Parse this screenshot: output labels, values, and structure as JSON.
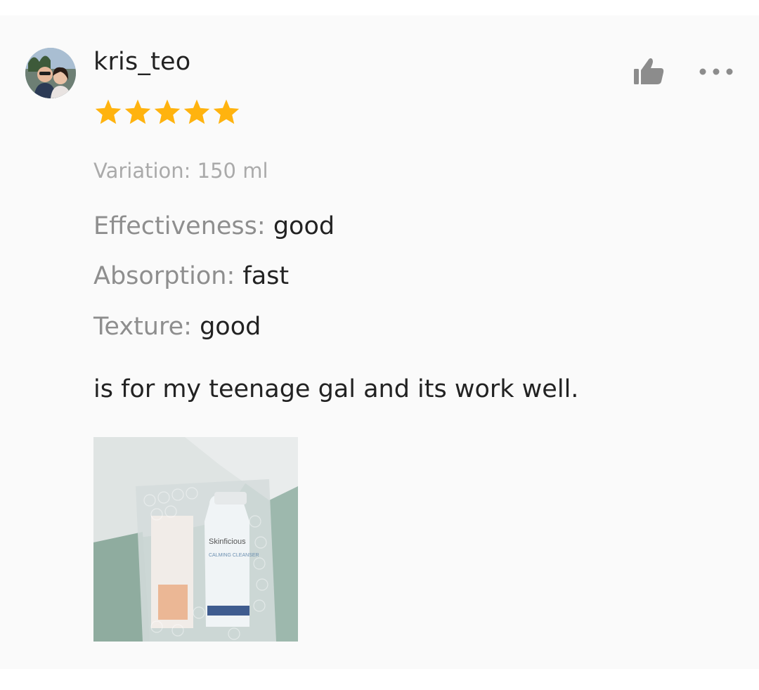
{
  "review": {
    "username": "kris_teo",
    "avatar": "avatar-photo",
    "rating": 5,
    "rating_max": 5,
    "star_color": "#ffb30f",
    "variation": "Variation: 150 ml",
    "attributes": [
      {
        "label": "Effectiveness:",
        "value": "good"
      },
      {
        "label": "Absorption:",
        "value": "fast"
      },
      {
        "label": "Texture:",
        "value": "good"
      }
    ],
    "comment": "is for my teenage gal and its work well.",
    "photo": {
      "icon": "product-photo",
      "bottle_brand": "Skinficious",
      "bottle_label": "CALMING CLEANSER"
    },
    "actions": {
      "like_icon": "thumbs-up-icon",
      "more_icon": "more-options-icon"
    }
  }
}
